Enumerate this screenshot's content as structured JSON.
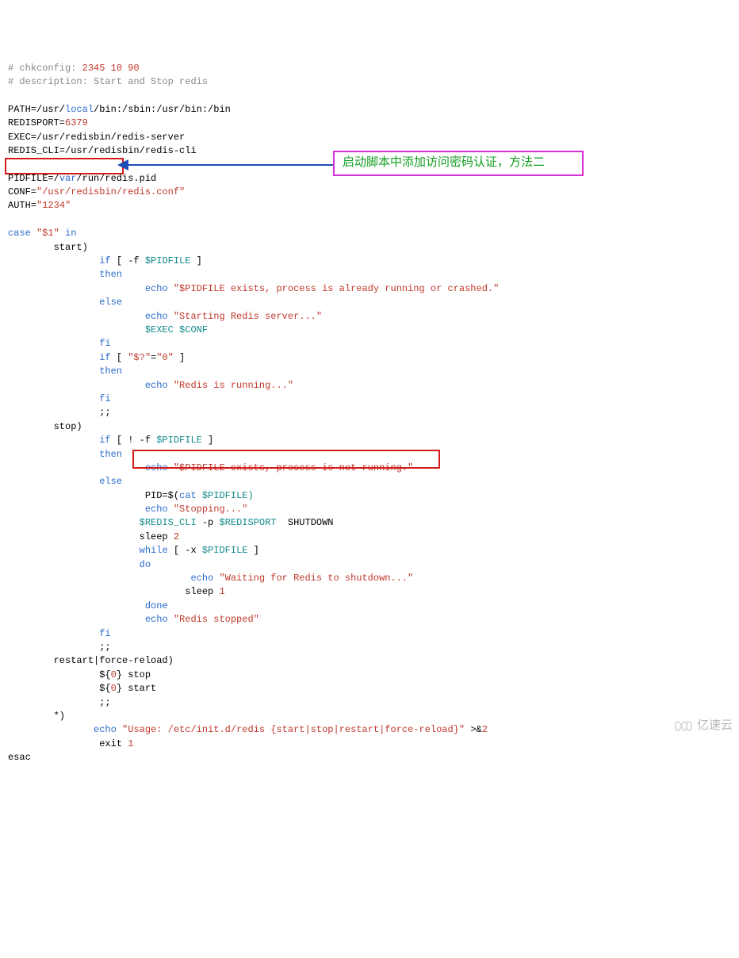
{
  "annotation_text": "启动脚本中添加访问密码认证，方法二",
  "watermark_text": "亿速云",
  "code": {
    "l1a": "# chkconfig:",
    "l1b": " 2345 10 90",
    "l2": "# description: Start and Stop redis",
    "l3": "",
    "l4a": "PATH=/usr/",
    "l4b": "local",
    "l4c": "/bin:/sbin:/usr/bin:/bin",
    "l5a": "REDISPORT=",
    "l5b": "6379",
    "l6": "EXEC=/usr/redisbin/redis-server",
    "l7": "REDIS_CLI=/usr/redisbin/redis-cli",
    "l8": "",
    "l9a": "PIDFILE=/",
    "l9b": "var",
    "l9c": "/run/redis.pid",
    "l10a": "CONF=",
    "l10b": "\"/usr/redisbin/redis.conf\"",
    "l11a": "AUTH=",
    "l11b": "\"1234\"",
    "l12": "",
    "l13a": "case",
    "l13b": " \"$1\" ",
    "l13c": "in",
    "l14": "        start)",
    "l15a": "                ",
    "l15b": "if",
    "l15c": " [ -f ",
    "l15d": "$PIDFILE",
    "l15e": " ]",
    "l16a": "                ",
    "l16b": "then",
    "l16_2a": "                        ",
    "l16_2b": "echo",
    "l16_2c": " \"$PIDFILE exists, process is already running or crashed.\"",
    "l17a": "                ",
    "l17b": "else",
    "l18a": "                        ",
    "l18b": "echo",
    "l18c": " \"Starting Redis server...\"",
    "l19a": "                        ",
    "l19b": "$EXEC",
    "l19c": " $CONF",
    "l20a": "                ",
    "l20b": "fi",
    "l21a": "                ",
    "l21b": "if",
    "l21c": " [ ",
    "l21d": "\"$?\"",
    "l21e": "=",
    "l21f": "\"0\"",
    "l21g": " ]",
    "l22a": "                ",
    "l22b": "then",
    "l23a": "                        ",
    "l23b": "echo",
    "l23c": " \"Redis is running...\"",
    "l24a": "                ",
    "l24b": "fi",
    "l25": "                ;;",
    "l26": "        stop)",
    "l27a": "                ",
    "l27b": "if",
    "l27c": " [ ! -f ",
    "l27d": "$PIDFILE",
    "l27e": " ]",
    "l28a": "                ",
    "l28b": "then",
    "l29a": "                        ",
    "l29b": "echo",
    "l29c": " \"$PIDFILE exists, process is not running.\"",
    "l30a": "                ",
    "l30b": "else",
    "l31a": "                        PID=$(",
    "l31b": "cat",
    "l31c": " $PIDFILE)",
    "l32a": "                        ",
    "l32b": "echo",
    "l32c": " \"Stopping...\"",
    "l33a": "                       ",
    "l33b": "$REDIS_CLI",
    "l33c": " -p ",
    "l33d": "$REDISPORT",
    "l33e": "  SHUTDOWN",
    "l34a": "                       sleep ",
    "l34b": "2",
    "l35a": "                       ",
    "l35b": "while",
    "l35c": " [ -x ",
    "l35d": "$PIDFILE",
    "l35e": " ]",
    "l36a": "                       ",
    "l36b": "do",
    "l37a": "                                ",
    "l37b": "echo",
    "l37c": " \"Waiting for Redis to shutdown...\"",
    "l38a": "                               sleep ",
    "l38b": "1",
    "l39a": "                        ",
    "l39b": "done",
    "l40a": "                        ",
    "l40b": "echo",
    "l40c": " \"Redis stopped\"",
    "l41a": "                ",
    "l41b": "fi",
    "l42": "                ;;",
    "l43": "        restart|force-reload)",
    "l44a": "                ${",
    "l44b": "0",
    "l44c": "} stop",
    "l45a": "                ${",
    "l45b": "0",
    "l45c": "} start",
    "l46": "                ;;",
    "l47": "        *)",
    "l48a": "               ",
    "l48b": "echo",
    "l48c": " \"Usage: /etc/init.d/redis {start|stop|restart|force-reload}\"",
    "l48d": " >&",
    "l48e": "2",
    "l49a": "                exit ",
    "l49b": "1",
    "l50": "esac"
  }
}
